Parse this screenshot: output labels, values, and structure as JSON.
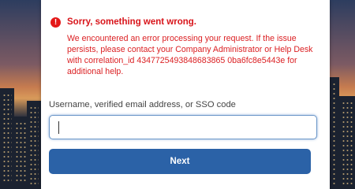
{
  "colors": {
    "error_red": "#d8141a",
    "button_blue": "#2b62a7",
    "input_focus_border": "#6b96c8",
    "card_background": "#ffffff"
  },
  "error": {
    "icon": "exclamation-circle-icon",
    "icon_glyph": "!",
    "title": "Sorry, something went wrong.",
    "message": "We encountered an error processing your request. If the issue persists, please contact your Company Administrator or Help Desk with correlation_id 4347725493848683865 0ba6fc8e5443e for additional help."
  },
  "login": {
    "field_label": "Username, verified email address, or SSO code",
    "field_value": "",
    "field_placeholder": "",
    "next_label": "Next"
  }
}
